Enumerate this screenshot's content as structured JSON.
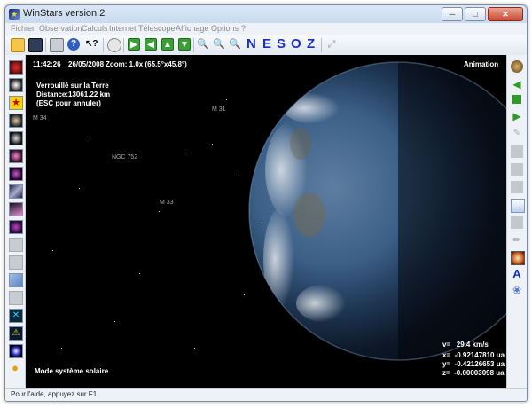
{
  "window": {
    "title": "WinStars version 2"
  },
  "menu": [
    "Fichier",
    "Observation",
    "Calculs",
    "Internet",
    "Télescope",
    "Affichage",
    "Options",
    "?"
  ],
  "toolbar": {
    "cardinals": [
      "N",
      "E",
      "S",
      "O",
      "Z"
    ]
  },
  "hud": {
    "time": "11:42:26",
    "date": "26/05/2008",
    "zoom": "Zoom: 1.0x (65.5°x45.8°)",
    "mode_label": "Animation",
    "lock_line1": "Verrouillé sur la Terre",
    "lock_line2": "Distance:13061.22 km",
    "lock_line3": "(ESC pour annuler)",
    "velocity": "v=   29.4 km/s",
    "x": "x=  -0.92147810 ua",
    "y": "y=  -0.42126653 ua",
    "z": "z=  -0.00003098 ua",
    "solar_mode": "Mode système solaire"
  },
  "sky_objects": [
    "M 34",
    "M 31",
    "NGC 752",
    "M 33"
  ],
  "statusbar": {
    "text": "Pour l'aide, appuyez sur F1"
  },
  "colors": {
    "sky": "#000000",
    "cardinal_letters": "#1732c2",
    "earth_ocean": "#2b4d79"
  }
}
